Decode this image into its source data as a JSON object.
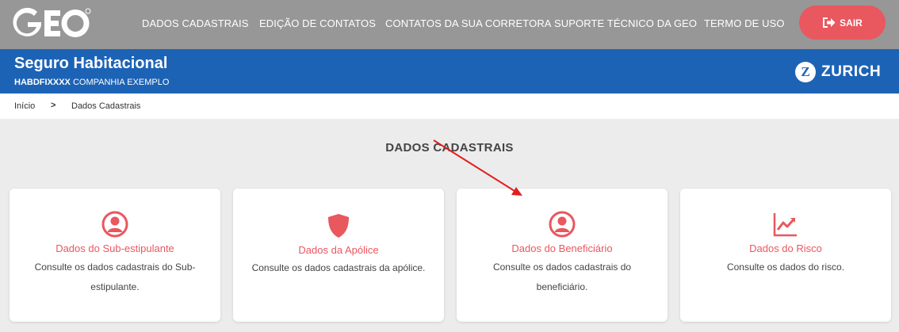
{
  "header": {
    "logo_text": "GEO",
    "nav": [
      {
        "label": "DADOS CADASTRAIS"
      },
      {
        "label": "EDIÇÃO DE CONTATOS"
      },
      {
        "label": "CONTATOS DA SUA CORRETORA"
      },
      {
        "label": "SUPORTE TÉCNICO DA GEO"
      },
      {
        "label": "TERMO DE USO"
      }
    ],
    "logout_label": "SAIR",
    "logout_icon": "sign-out-icon"
  },
  "product": {
    "title": "Seguro Habitacional",
    "code": "HABDFIXXXX",
    "company": "COMPANHIA EXEMPLO",
    "insurer_logo_text": "ZURICH",
    "insurer_mark": "Z"
  },
  "breadcrumb": {
    "items": [
      "Início",
      "Dados Cadastrais"
    ],
    "separator": ">"
  },
  "section": {
    "title": "DADOS CADASTRAIS"
  },
  "cards": [
    {
      "title": "Dados do Sub-estipulante",
      "description": "Consulte os dados cadastrais do Sub-estipulante.",
      "icon": "user-circle-icon"
    },
    {
      "title": "Dados da Apólice",
      "description": "Consulte os dados cadastrais da apólice.",
      "icon": "shield-icon"
    },
    {
      "title": "Dados do Beneficiário",
      "description": "Consulte os dados cadastrais do beneficiário.",
      "icon": "user-circle-icon"
    },
    {
      "title": "Dados do Risco",
      "description": "Consulte os dados do risco.",
      "icon": "trend-chart-icon"
    }
  ],
  "colors": {
    "accent": "#e9575f",
    "brand_blue": "#1d63b5",
    "topbar_gray": "#979797",
    "annotation_arrow": "#e11f1f"
  }
}
